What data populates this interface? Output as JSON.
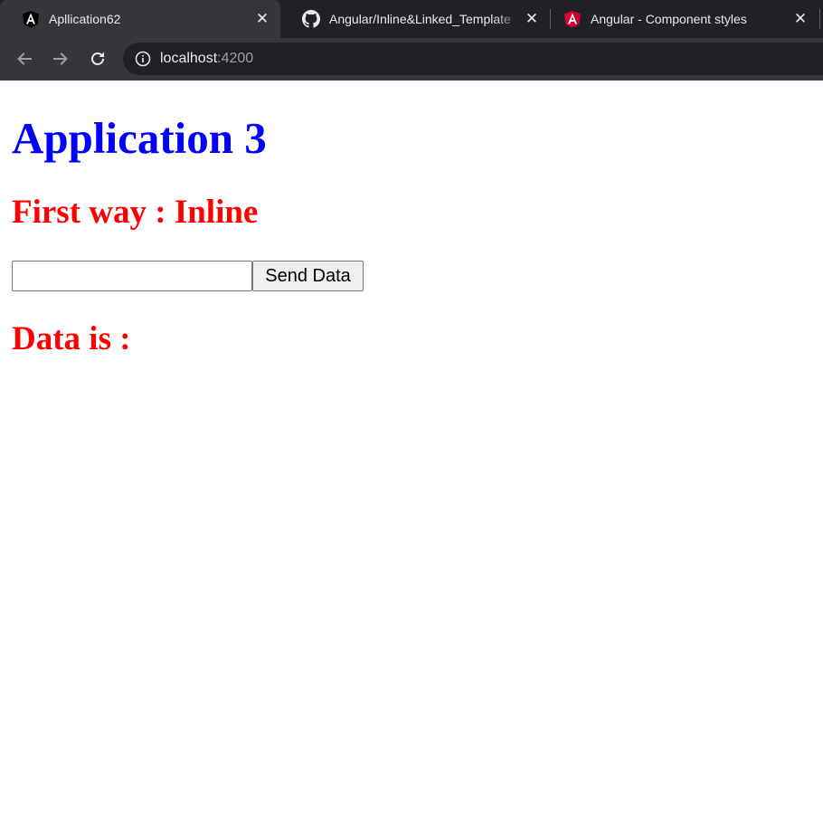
{
  "browser": {
    "tabs": [
      {
        "title": "Apllication62",
        "favicon": "angular-cli-icon",
        "active": true
      },
      {
        "title": "Angular/Inline&Linked_Template",
        "favicon": "github-icon",
        "active": false
      },
      {
        "title": "Angular - Component styles",
        "favicon": "angular-icon",
        "active": false
      }
    ],
    "address": {
      "host": "localhost",
      "port": ":4200"
    }
  },
  "page": {
    "title": "Application 3",
    "subtitle": "First way : Inline",
    "input": {
      "value": "",
      "placeholder": ""
    },
    "send_button": "Send Data",
    "data_label": "Data is :"
  },
  "colors": {
    "title": "#0000ff",
    "headings": "#ff0000",
    "chrome_dark": "#202124",
    "chrome_toolbar": "#35363a"
  }
}
